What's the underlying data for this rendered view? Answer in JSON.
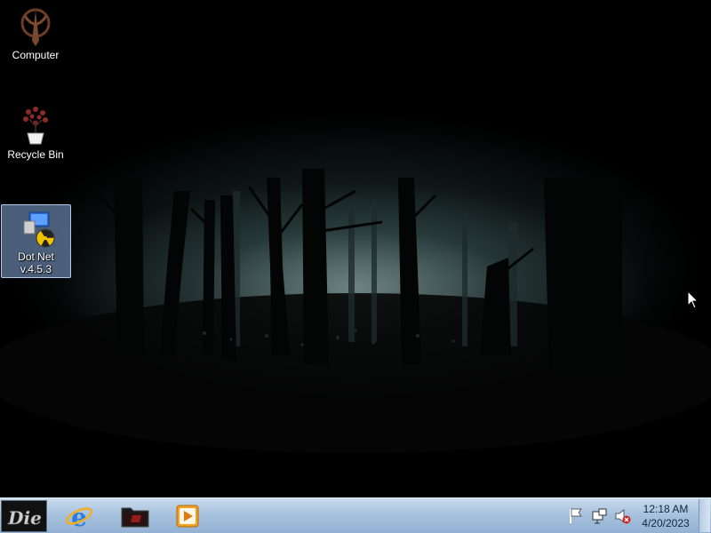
{
  "desktop": {
    "icons": [
      {
        "label": "Computer",
        "icon": "quake-logo-icon"
      },
      {
        "label": "Recycle Bin",
        "icon": "potted-plant-icon"
      },
      {
        "label_line1": "Dot Net",
        "label_line2": "v.4.5.3",
        "icon": "dotnet-installer-icon",
        "selected": true
      }
    ]
  },
  "taskbar": {
    "start_button": {
      "icon": "start-orb-icon",
      "text": "Die"
    },
    "pinned": [
      {
        "name": "Internet Explorer",
        "icon": "ie-icon"
      },
      {
        "name": "Folder",
        "icon": "dark-folder-icon"
      },
      {
        "name": "Media Player",
        "icon": "media-player-icon"
      }
    ],
    "tray": {
      "icons": [
        "action-center-flag-icon",
        "network-icon",
        "volume-muted-icon"
      ]
    },
    "clock": {
      "time": "12:18 AM",
      "date": "4/20/2023"
    }
  },
  "colors": {
    "taskbar_top": "#c9dbed",
    "taskbar_bottom": "#93b1d3",
    "selection": "#87aadc",
    "fog": "#afc8c8"
  }
}
